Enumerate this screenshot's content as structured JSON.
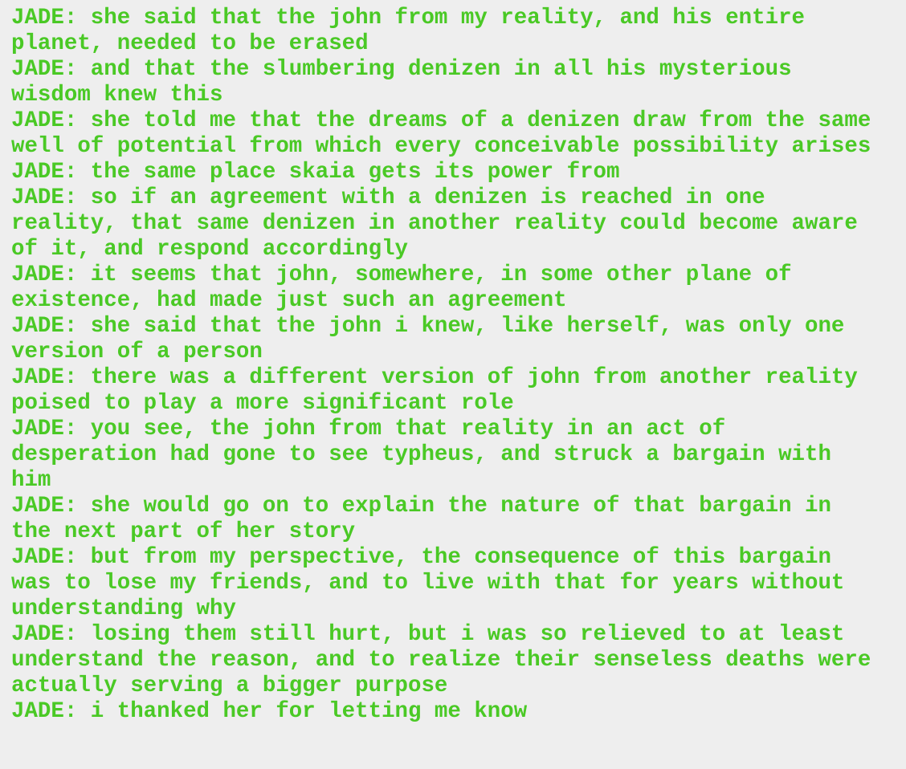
{
  "dialogue": {
    "lines": [
      "JADE: she said that the john from my reality, and his entire planet, needed to be erased",
      "JADE: and that the slumbering denizen in all his mysterious wisdom knew this",
      "JADE: she told me that the dreams of a denizen draw from the same well of potential from which every conceivable possibility arises",
      "JADE: the same place skaia gets its power from",
      "JADE: so if an agreement with a denizen is reached in one reality, that same denizen in another reality could become aware of it, and respond accordingly",
      "JADE: it seems that john, somewhere, in some other plane of existence, had made just such an agreement",
      "JADE: she said that the john i knew, like herself, was only one version of a person",
      "JADE: there was a different version of john from another reality poised to play a more significant role",
      "JADE: you see, the john from that reality in an act of desperation had gone to see typheus, and struck a bargain with him",
      "JADE: she would go on to explain the nature of that bargain in the next part of her story",
      "JADE: but from my perspective, the consequence of this bargain was to lose my friends, and to live with that for years without understanding why",
      "JADE: losing them still hurt, but i was so relieved to at least understand the reason, and to realize their senseless deaths were actually serving a bigger purpose",
      "JADE: i thanked her for letting me know"
    ]
  },
  "colors": {
    "background": "#eeeeee",
    "jade_text": "#4ac925"
  }
}
